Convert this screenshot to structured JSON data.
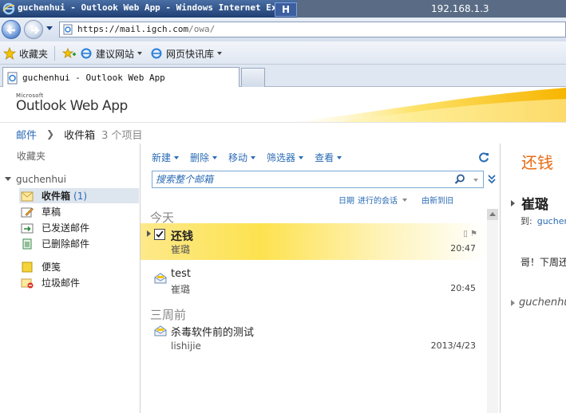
{
  "browser": {
    "window_title": "guchenhui - Outlook Web App - Windows Internet Explorer",
    "host_badge": "H",
    "remote_ip": "192.168.1.3",
    "url_host": "https://mail.igch.com",
    "url_path": "/owa/",
    "favorites_label": "收藏夹",
    "fav_suggested": "建议网站",
    "fav_webslice": "网页快讯库",
    "tab_title": "guchenhui - Outlook Web App"
  },
  "owa": {
    "brand_small": "Microsoft",
    "brand": "Outlook Web App"
  },
  "breadcrumb": {
    "root": "邮件",
    "current": "收件箱",
    "count": "3 个项目"
  },
  "nav": {
    "favorites": "收藏夹",
    "account": "guchenhui",
    "items": [
      {
        "label": "收件箱",
        "count": "(1)",
        "icon": "inbox-icon"
      },
      {
        "label": "草稿",
        "icon": "drafts-icon"
      },
      {
        "label": "已发送邮件",
        "icon": "sent-icon"
      },
      {
        "label": "已删除邮件",
        "icon": "deleted-icon"
      },
      {
        "label": "便笺",
        "icon": "notes-icon"
      },
      {
        "label": "垃圾邮件",
        "icon": "junk-icon"
      }
    ]
  },
  "toolbar": {
    "new": "新建",
    "delete": "删除",
    "move": "移动",
    "filter": "筛选器",
    "view": "查看"
  },
  "search": {
    "placeholder": "搜索整个邮箱"
  },
  "sort": {
    "date": "日期",
    "mode": "进行的会话",
    "order": "由新到旧"
  },
  "groups": {
    "today": "今天",
    "three_weeks": "三周前"
  },
  "messages": [
    {
      "subject": "还钱",
      "sender": "崔璐",
      "time": "20:47",
      "selected": true,
      "unread": true
    },
    {
      "subject": "test",
      "sender": "崔璐",
      "time": "20:45",
      "selected": false
    },
    {
      "subject": "杀毒软件前的测试",
      "sender": "lishijie",
      "time": "2013/4/23",
      "selected": false
    }
  ],
  "reading": {
    "subject": "还钱",
    "sender": "崔璐",
    "to_label": "到:",
    "to_value": "guchenhui",
    "body": "哥！下周还你",
    "thread_label": "guchenhui"
  },
  "colors": {
    "accent_orange": "#e86a10",
    "link_blue": "#2a6bb5",
    "selection_yellow": "#fde24f",
    "nav_selected": "#dde5ee"
  }
}
